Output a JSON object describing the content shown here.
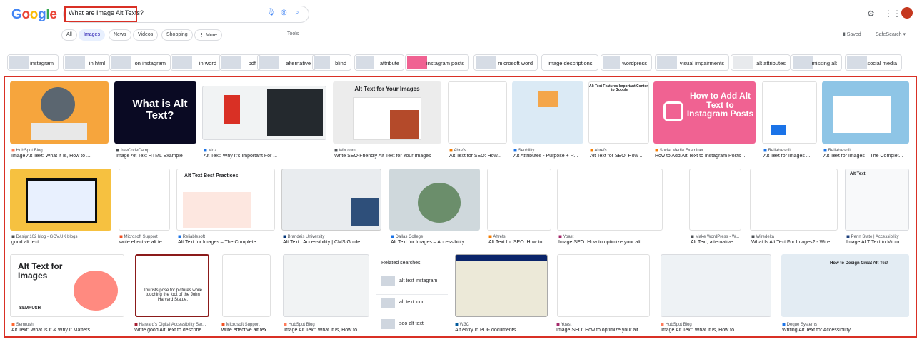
{
  "logo": "Google",
  "search": {
    "query": "What are Image Alt Texts?"
  },
  "tabs": [
    {
      "label": "All"
    },
    {
      "label": "Images"
    },
    {
      "label": "News"
    },
    {
      "label": "Videos"
    },
    {
      "label": "Shopping"
    },
    {
      "label": "⋮ More"
    }
  ],
  "tools": "Tools",
  "saved": "Saved",
  "safesearch": "SafeSearch ▾",
  "chips": [
    "instagram",
    "in html",
    "on instagram",
    "in word",
    "pdf",
    "alternative",
    "blind",
    "attribute",
    "instagram posts",
    "microsoft word",
    "image descriptions",
    "wordpress",
    "visual impairments",
    "alt attributes",
    "missing alt",
    "social media"
  ],
  "images_text": {
    "a2": "What is Alt Text?",
    "a4": "Alt Text for Your Images",
    "a7": "Alt Text Features Important Content to Google",
    "a8": "How to Add Alt Text to Instagram Posts",
    "b2": "Alt Text Best Practices",
    "b9": "Alt Text",
    "c1": "Alt Text for Images",
    "c1b": "SEMRUSH",
    "c2": "Tourists pose for pictures while touching the foot of the John Harvard Statue.",
    "c7": "How to Design Great Alt Text"
  },
  "results": [
    {
      "src": "HubSpot Blog",
      "title": "Image Alt Text: What It Is, How to ..."
    },
    {
      "src": "freeCodeCamp",
      "title": "Image Alt Text HTML Example"
    },
    {
      "src": "Moz",
      "title": "Alt Text: Why It's Important For ..."
    },
    {
      "src": "Wix.com",
      "title": "Write SEO-Friendly Alt Text for Your Images"
    },
    {
      "src": "Ahrefs",
      "title": "Alt Text for SEO: How..."
    },
    {
      "src": "Seobility",
      "title": "Alt Attributes - Purpose + R..."
    },
    {
      "src": "Ahrefs",
      "title": "Alt Text for SEO: How ..."
    },
    {
      "src": "Social Media Examiner",
      "title": "How to Add Alt Text to Instagram Posts ..."
    },
    {
      "src": "Reliablesoft",
      "title": "Alt Text for Images ..."
    },
    {
      "src": "Reliablesoft",
      "title": "Alt Text for Images – The Complet..."
    },
    {
      "src": "Design102 blog - GOV.UK blogs",
      "title": "good alt text ..."
    },
    {
      "src": "Microsoft Support",
      "title": "write effective alt te..."
    },
    {
      "src": "Reliablesoft",
      "title": "Alt Text for Images – The Complete ..."
    },
    {
      "src": "Brandeis University",
      "title": "Alt Text | Accessibility | CMS Guide ..."
    },
    {
      "src": "Dallas College",
      "title": "Alt Text for Images – Accessibility ..."
    },
    {
      "src": "Ahrefs",
      "title": "Alt Text for SEO: How to ..."
    },
    {
      "src": "Yoast",
      "title": "Image SEO: How to optimize your alt ..."
    },
    {
      "src": "Make WordPress - W...",
      "title": "Alt Text, alternative ..."
    },
    {
      "src": "Wiredelta",
      "title": "What Is Alt Text For Images? - Wire..."
    },
    {
      "src": "Penn State | Accessibility",
      "title": "Image ALT Text in Micro..."
    },
    {
      "src": "Semrush",
      "title": "Alt Text: What Is It & Why It Matters ..."
    },
    {
      "src": "Harvard's Digital Accessibility Ser...",
      "title": "Write good Alt Text to describe ..."
    },
    {
      "src": "Microsoft Support",
      "title": "write effective alt tex..."
    },
    {
      "src": "HubSpot Blog",
      "title": "Image Alt Text: What It Is, How to ..."
    },
    {
      "src": "W3C",
      "title": "Alt entry in PDF documents ..."
    },
    {
      "src": "Yoast",
      "title": "Image SEO: How to optimize your alt ..."
    },
    {
      "src": "HubSpot Blog",
      "title": "Image Alt Text: What It Is, How to ..."
    },
    {
      "src": "Deque Systems",
      "title": "Writing Alt Text for Accessibility ..."
    }
  ],
  "related": {
    "heading": "Related searches",
    "items": [
      "alt text instagram",
      "alt text icon",
      "seo alt text"
    ]
  }
}
